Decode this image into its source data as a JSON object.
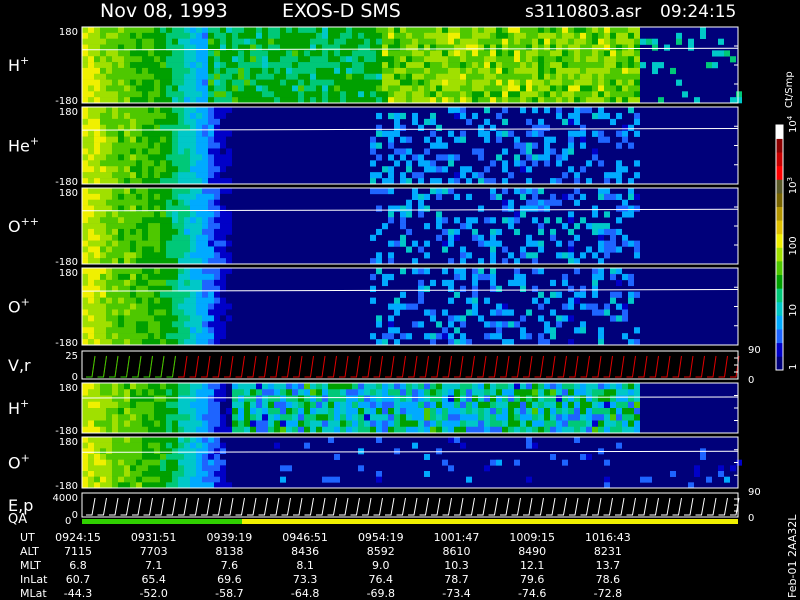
{
  "header": {
    "date": "Nov 08, 1993",
    "instrument": "EXOS-D SMS",
    "file": "s3110803.asr",
    "time": "09:24:15"
  },
  "chart_data": {
    "type": "heatmap",
    "panels": [
      {
        "label": "H",
        "sup": "+",
        "ymax": "180",
        "ymin": "-180"
      },
      {
        "label": "He",
        "sup": "+",
        "ymax": "180",
        "ymin": "-180"
      },
      {
        "label": "O",
        "sup": "++",
        "ymax": "180",
        "ymin": "-180"
      },
      {
        "label": "O",
        "sup": "+",
        "ymax": "180",
        "ymin": "-180"
      },
      {
        "label": "V,r",
        "sup": "",
        "ymax": "25",
        "ymin": "0"
      },
      {
        "label": "H",
        "sup": "+",
        "ymax": "180",
        "ymin": "-180"
      },
      {
        "label": "O",
        "sup": "+",
        "ymax": "180",
        "ymin": "-180"
      },
      {
        "label": "E,p",
        "sup": "",
        "ymax": "4000",
        "ymin": "0"
      }
    ],
    "qa_label": "QA",
    "qa_zero": "0",
    "right_axis": [
      {
        "value": "90",
        "panel": 4,
        "pos": "top"
      },
      {
        "value": "0",
        "panel": 4,
        "pos": "bottom"
      },
      {
        "value": "90",
        "panel": 7,
        "pos": "top"
      },
      {
        "value": "0",
        "panel": 7,
        "pos": "bottom"
      }
    ],
    "colorbar": {
      "unit": "Ct/Smp",
      "ticks": [
        {
          "label": "10",
          "exp": "4",
          "level": 4
        },
        {
          "label": "10",
          "exp": "3",
          "level": 3
        },
        {
          "label": "100",
          "exp": "",
          "level": 2
        },
        {
          "label": "10",
          "exp": "",
          "level": 1
        },
        {
          "label": "1",
          "exp": "",
          "level": 0
        }
      ],
      "colors": [
        "#00007a",
        "#0000c8",
        "#1e64ff",
        "#00aaff",
        "#00c8c8",
        "#00c878",
        "#00a000",
        "#4ec800",
        "#a0e000",
        "#f0f000",
        "#e0c000",
        "#b49600",
        "#786400",
        "#5a5a28",
        "#ff0000",
        "#c80000",
        "#8c0000",
        "#ffffff"
      ]
    },
    "orbit_table": {
      "rows": [
        {
          "name": "UT",
          "values": [
            "0924:15",
            "0931:51",
            "0939:19",
            "0946:51",
            "0954:19",
            "1001:47",
            "1009:15",
            "1016:43"
          ]
        },
        {
          "name": "ALT",
          "values": [
            "7115",
            "7703",
            "8138",
            "8436",
            "8592",
            "8610",
            "8490",
            "8231"
          ]
        },
        {
          "name": "MLT",
          "values": [
            "6.8",
            "7.1",
            "7.6",
            "8.1",
            "9.0",
            "10.3",
            "12.1",
            "13.7"
          ]
        },
        {
          "name": "InLat",
          "values": [
            "60.7",
            "65.4",
            "69.6",
            "73.3",
            "76.4",
            "78.7",
            "79.6",
            "78.6"
          ]
        },
        {
          "name": "MLat",
          "values": [
            "-44.3",
            "-52.0",
            "-58.7",
            "-64.8",
            "-69.8",
            "-73.4",
            "-74.6",
            "-72.8"
          ]
        }
      ]
    },
    "side_label": "Feb-01 2AA32L"
  }
}
